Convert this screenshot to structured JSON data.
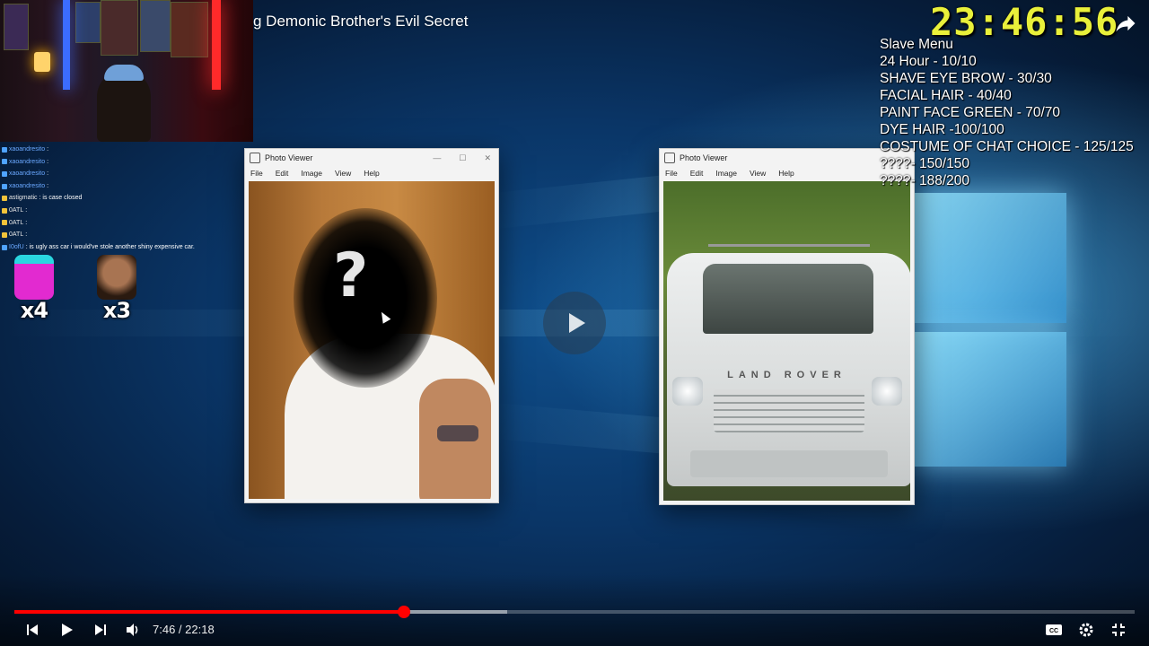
{
  "video": {
    "title": "g Demonic Brother's Evil Secret",
    "current_time": "7:46",
    "duration": "22:18",
    "time_separator": " / ",
    "progress_fraction": 0.3475,
    "buffer_fraction": 0.44
  },
  "overlay": {
    "timer": "23:46:56",
    "menu_items": [
      "Slave Menu",
      "24 Hour - 10/10",
      "SHAVE EYE BROW - 30/30",
      "FACIAL HAIR - 40/40",
      "PAINT FACE GREEN - 70/70",
      "DYE HAIR -100/100",
      "COSTUME OF CHAT CHOICE - 125/125",
      "????- 150/150",
      "????- 188/200"
    ]
  },
  "chat": {
    "messages": [
      {
        "user": "xaoandresito",
        "text": ":",
        "badge": "blue"
      },
      {
        "user": "xaoandresito",
        "text": ":",
        "badge": "blue"
      },
      {
        "user": "xaoandresito",
        "text": ":",
        "badge": "blue"
      },
      {
        "user": "xaoandresito",
        "text": ":",
        "badge": "blue"
      },
      {
        "user": "astigmatic",
        "text": ": is case closed",
        "badge": "yellow"
      },
      {
        "user": "0ATL",
        "text": ":",
        "badge": "yellow"
      },
      {
        "user": "0ATL",
        "text": ":",
        "badge": "yellow"
      },
      {
        "user": "0ATL",
        "text": ":",
        "badge": "yellow"
      },
      {
        "user": "I0ofU",
        "text": ": is ugly ass car i would've stole another shiny expensive car.",
        "badge": "blue"
      }
    ],
    "emote_counts": [
      "x4",
      "x3"
    ]
  },
  "windows": {
    "left": {
      "title": "Photo Viewer",
      "menu": [
        "File",
        "Edit",
        "Image",
        "View",
        "Help"
      ],
      "overlay_text": "?"
    },
    "right": {
      "title": "Photo Viewer",
      "menu": [
        "File",
        "Edit",
        "Image",
        "View",
        "Help"
      ],
      "car_brand": "LAND ROVER"
    }
  },
  "icons": {
    "play": "play-icon",
    "prev": "skip-previous-icon",
    "next": "skip-next-icon",
    "volume": "volume-icon",
    "cc": "closed-captions-icon",
    "settings": "gear-icon",
    "fullscreen": "exit-fullscreen-icon",
    "share": "share-icon"
  },
  "colors": {
    "progress_played": "#ff0000",
    "timer": "#e9f03a"
  }
}
